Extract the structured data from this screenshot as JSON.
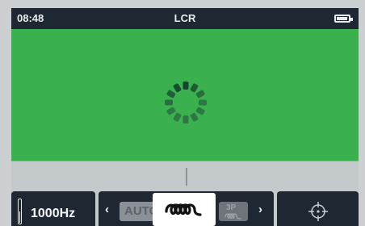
{
  "statusbar": {
    "time": "08:48",
    "title": "LCR",
    "battery_icon": "battery-icon"
  },
  "main": {
    "background_color": "#3bb04f",
    "loading_icon": "loading-spinner-icon"
  },
  "bottombar": {
    "frequency": "1000Hz",
    "mode_options": {
      "auto_label": "AUTO",
      "inductor_icon": "inductor-coil-icon",
      "three_phase_label": "3P",
      "three_phase_icon": "inductor-coil-icon"
    },
    "prev_icon": "chevron-left-icon",
    "next_icon": "chevron-right-icon",
    "target_icon": "crosshair-icon"
  }
}
